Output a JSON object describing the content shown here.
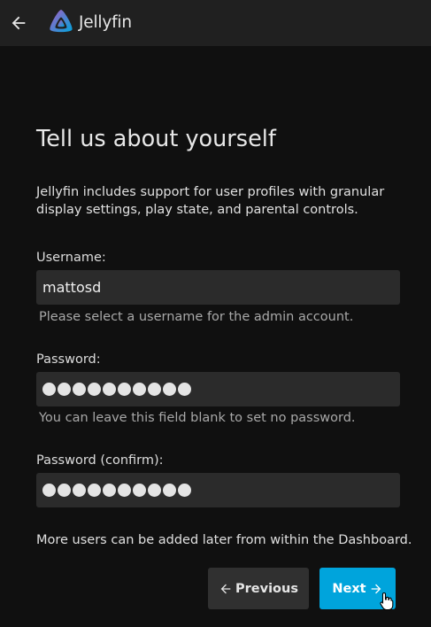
{
  "header": {
    "logo_text": "Jellyfin",
    "back_icon": "arrow-left-icon",
    "brand_colors": [
      "#aa5cc3",
      "#00a4dc"
    ]
  },
  "main": {
    "title": "Tell us about yourself",
    "intro": "Jellyfin includes support for user profiles with granular display settings, play state, and parental controls.",
    "username": {
      "label": "Username:",
      "value": "mattosd",
      "help": "Please select a username for the admin account."
    },
    "password": {
      "label": "Password:",
      "masked_length": 10,
      "help": "You can leave this field blank to set no password."
    },
    "password_confirm": {
      "label": "Password (confirm):",
      "masked_length": 10
    },
    "footer_note": "More users can be added later from within the Dashboard."
  },
  "buttons": {
    "previous_label": "Previous",
    "next_label": "Next",
    "accent_color": "#00a4dc"
  }
}
